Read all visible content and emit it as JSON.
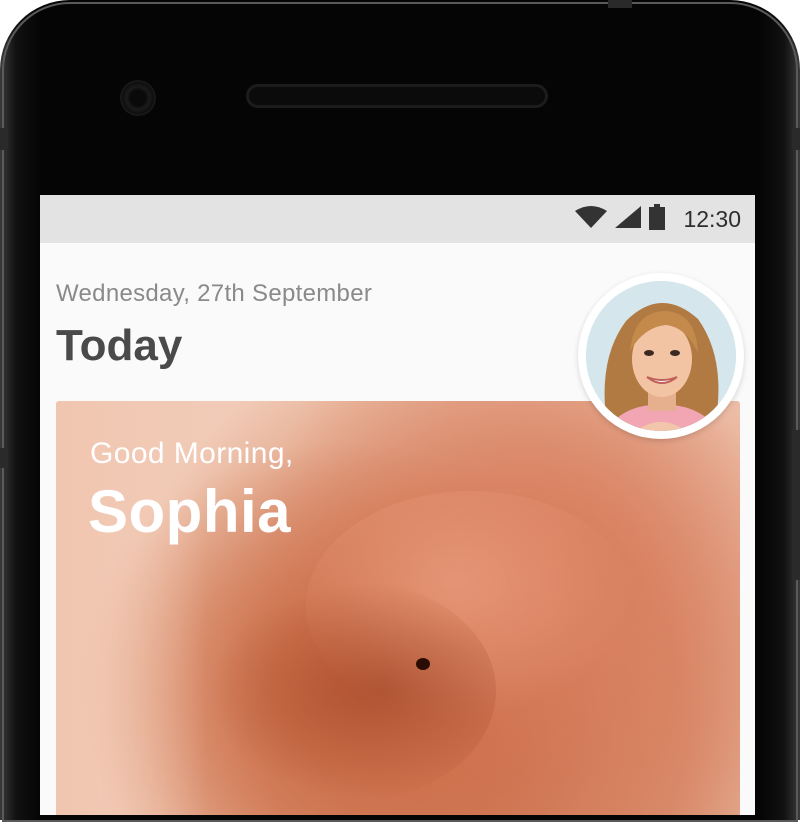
{
  "status_bar": {
    "time": "12:30",
    "icons": [
      "wifi-icon",
      "cellular-signal-icon",
      "battery-icon"
    ]
  },
  "header": {
    "date": "Wednesday, 27th September",
    "title": "Today"
  },
  "hero": {
    "greeting": "Good Morning,",
    "name": "Sophia"
  },
  "avatar": {
    "icon": "user-avatar-photo"
  },
  "colors": {
    "status_bar_bg": "#e3e3e3",
    "title_text": "#4a4a4a",
    "date_text": "#8a8a8a",
    "hero_text": "#ffffff"
  }
}
